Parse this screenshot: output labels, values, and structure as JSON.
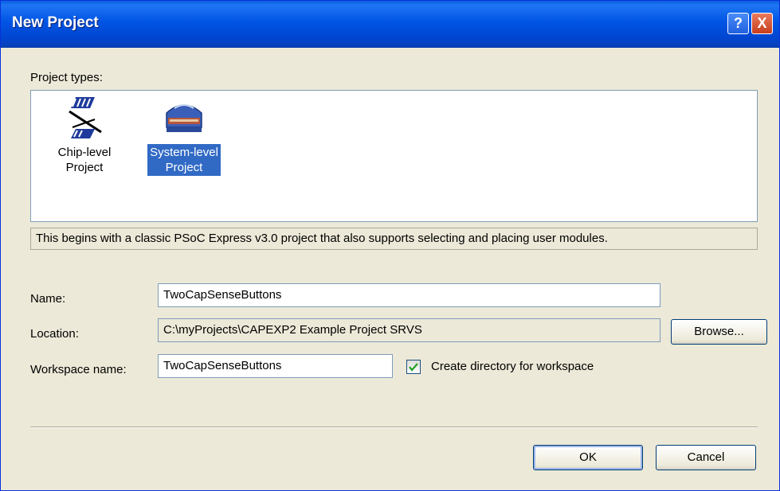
{
  "window": {
    "title": "New Project",
    "help_label": "?",
    "close_label": "X"
  },
  "project_types": {
    "label": "Project types:",
    "items": [
      {
        "line1": "Chip-level",
        "line2": "Project",
        "icon": "chip-level-icon",
        "selected": false
      },
      {
        "line1": "System-level",
        "line2": "Project",
        "icon": "system-level-icon",
        "selected": true
      }
    ],
    "description": "This begins with a classic PSoC Express v3.0 project that also supports selecting and placing user modules."
  },
  "form": {
    "name_label": "Name:",
    "name_value": "TwoCapSenseButtons",
    "location_label": "Location:",
    "location_value": "C:\\myProjects\\CAPEXP2 Example Project SRVS",
    "browse_label": "Browse...",
    "workspace_label": "Workspace name:",
    "workspace_value": "TwoCapSenseButtons",
    "create_dir_label": "Create directory for workspace",
    "create_dir_checked": true
  },
  "buttons": {
    "ok": "OK",
    "cancel": "Cancel"
  },
  "colors": {
    "title_bar": "#0055e5",
    "selection": "#316ac5",
    "dialog_bg": "#ece9d8"
  }
}
